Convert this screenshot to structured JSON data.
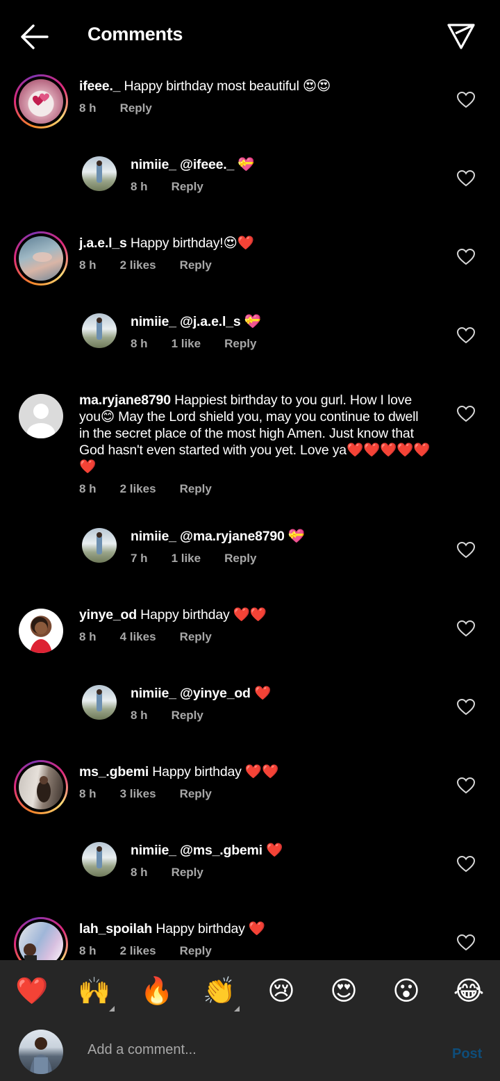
{
  "header": {
    "title": "Comments"
  },
  "comments": [
    {
      "username": "ifeee._",
      "text": "Happy birthday most beautiful 😍😍",
      "time": "8 h",
      "likes": "",
      "reply": "Reply"
    },
    {
      "username": "nimiie_",
      "mention": "@ifeee._",
      "text": "💝",
      "time": "8 h",
      "likes": "",
      "reply": "Reply"
    },
    {
      "username": "j.a.e.l_s",
      "text": "Happy birthday!😍❤️",
      "time": "8 h",
      "likes": "2 likes",
      "reply": "Reply"
    },
    {
      "username": "nimiie_",
      "mention": "@j.a.e.l_s",
      "text": "💝",
      "time": "8 h",
      "likes": "1 like",
      "reply": "Reply"
    },
    {
      "username": "ma.ryjane8790",
      "text_lines": [
        "Happiest birthday to you gurl. How I love",
        "you😊  May the Lord shield you, may you continue to dwell",
        "in the secret place of the most high Amen. Just know that",
        "God hasn't even started with you yet. Love ya❤️❤️❤️❤️❤️",
        "❤️"
      ],
      "time": "8 h",
      "likes": "2 likes",
      "reply": "Reply"
    },
    {
      "username": "nimiie_",
      "mention": "@ma.ryjane8790",
      "text": "💝",
      "time": "7 h",
      "likes": "1 like",
      "reply": "Reply"
    },
    {
      "username": "yinye_od",
      "text": "Happy birthday ❤️❤️",
      "time": "8 h",
      "likes": "4 likes",
      "reply": "Reply"
    },
    {
      "username": "nimiie_",
      "mention": "@yinye_od",
      "text": "❤️",
      "time": "8 h",
      "likes": "",
      "reply": "Reply"
    },
    {
      "username": "ms_.gbemi",
      "text": "Happy birthday ❤️❤️",
      "time": "8 h",
      "likes": "3 likes",
      "reply": "Reply"
    },
    {
      "username": "nimiie_",
      "mention": "@ms_.gbemi",
      "text": "❤️",
      "time": "8 h",
      "likes": "",
      "reply": "Reply"
    },
    {
      "username": "lah_spoilah",
      "text": "Happy birthday ❤️",
      "time": "8 h",
      "likes": "2 likes",
      "reply": "Reply"
    }
  ],
  "emojis": [
    "❤️",
    "🙌",
    "🔥",
    "👏",
    "😢",
    "😍",
    "😮",
    "😂"
  ],
  "compose": {
    "placeholder": "Add a comment...",
    "post_label": "Post"
  },
  "colors": {
    "background": "#000000",
    "meta_text": "#a8a8a8",
    "bar": "#262626",
    "post_disabled": "#0e4d7a"
  }
}
